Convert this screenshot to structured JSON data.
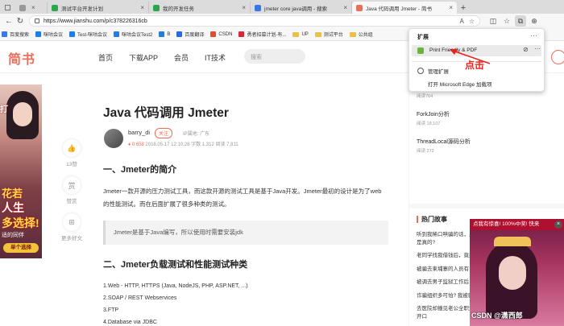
{
  "browser": {
    "tabs": [
      {
        "title": "",
        "color": "#999999"
      },
      {
        "title": "测试平台开发计划",
        "color": "#2aa64d"
      },
      {
        "title": "我的开发任务",
        "color": "#2aa64d"
      },
      {
        "title": "jmeter core java调用 - 搜索",
        "color": "#3b78e7"
      },
      {
        "title": "Java 代码调用 Jmeter - 简书",
        "color": "#ea6f5a"
      }
    ],
    "url": "https://www.jianshu.com/p/c378226316cb",
    "bookmarks": [
      {
        "label": "百度搜索",
        "color": "#3b78e7",
        "folder": false
      },
      {
        "label": "咪咕会议",
        "color": "#1e7ee6",
        "folder": false
      },
      {
        "label": "Test-咪咕会议",
        "color": "#1e7ee6",
        "folder": false
      },
      {
        "label": "咪咕会议Test2",
        "color": "#1e7ee6",
        "folder": false
      },
      {
        "label": "B",
        "color": "#1e7ee6",
        "folder": false
      },
      {
        "label": "百度翻译",
        "color": "#2468f2",
        "folder": false
      },
      {
        "label": "CSDN",
        "color": "#e64b2c",
        "folder": false
      },
      {
        "label": "勇者招募计划-有... ",
        "color": "#d8263a",
        "folder": false
      },
      {
        "label": "UP",
        "color": "#e8c04a",
        "folder": true
      },
      {
        "label": "测试平台",
        "color": "#e8c04a",
        "folder": true
      },
      {
        "label": "公共组",
        "color": "#e8c04a",
        "folder": true
      }
    ]
  },
  "site": {
    "logo": "简书",
    "nav": [
      "首页",
      "下载APP",
      "会员",
      "IT技术"
    ],
    "search_placeholder": "搜索"
  },
  "left_ad": {
    "line1": "打",
    "line2": "花若",
    "line3": "人生",
    "line4": "多选择!",
    "line5": "适的同伴",
    "button": "单个选择"
  },
  "side_actions": [
    {
      "icon": "thumb-up-icon",
      "glyph": "👍",
      "label": "13赞"
    },
    {
      "icon": "reward-icon",
      "glyph": "赏",
      "label": "赞赏"
    },
    {
      "icon": "more-articles-icon",
      "glyph": "⊞",
      "label": "更多好文"
    }
  ],
  "article": {
    "title": "Java 代码调用 Jmeter",
    "author": "barry_di",
    "follow": "关注",
    "ip": "IP属地: 广东",
    "meta_score": "0.658",
    "meta_rest": "2018.05.17 12:10:28   字数 1,312   阅读 7,811",
    "h1": "一、Jmeter的简介",
    "p1": "Jmeter一款开源的压力测试工具，而这款开源的测试工具是基于Java开发。Jmeter最初的设计是为了web的性能测试。而在后面扩展了很多种类的测试。",
    "quote": "Jmeter是基于Java编写，所以使用时需要安装jdk",
    "h2": "二、Jmeter负载测试和性能测试种类",
    "list": [
      "1.Web - HTTP, HTTPS (Java, NodeJS, PHP, ASP.NET, ...)",
      "2.SOAP / REST Webservices",
      "3.FTP",
      "4.Database via JDBC"
    ]
  },
  "sidebar": {
    "top_item_sub": "阅读764",
    "items": [
      {
        "title": "ForkJoin分析",
        "sub": "阅读 18,107"
      },
      {
        "title": "ThreadLocal源码分析",
        "sub": "阅读 272"
      }
    ],
    "hot_title": "热门故事",
    "hot": [
      "听到我稀口哄骗的话，皇帝竟红了眼：你说你如愿我，可是真的?",
      "老同学找我借钱后，竟然和对方这个门来做\"抵押\"",
      "被骗去柬埔寨的人员有，却有被你不知道的码标价",
      "被调去男子监狱工作后，这些吗么会紧?",
      "诈骗组织多可怕? 我被骗光了生活，遭受折磨",
      "去医院却撞见老公全职太太一样的人每天，我还没来得及开口"
    ]
  },
  "extension_popup": {
    "header": "扩展",
    "ext_name": "Print Friendly & PDF",
    "manage": "管理扩展",
    "open_addons": "打开 Microsoft Edge 加载项"
  },
  "annotation": {
    "text": "点击",
    "color": "#e8231e"
  },
  "game_ad": {
    "banner": "点我有惊喜! 100%中奖! 快来",
    "watermark": "CSDN @潇西郎"
  }
}
